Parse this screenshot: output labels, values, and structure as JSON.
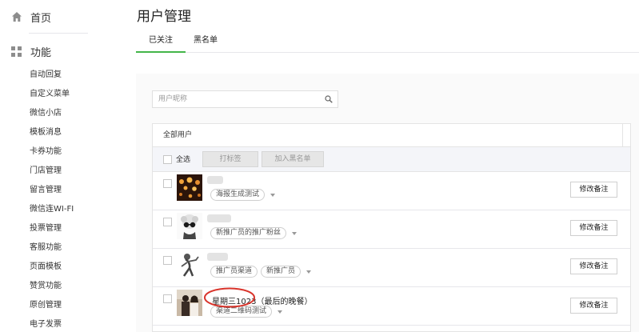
{
  "sidebar": {
    "home_label": "首页",
    "section_label": "功能",
    "items": [
      "自动回复",
      "自定义菜单",
      "微信小店",
      "模板消息",
      "卡券功能",
      "门店管理",
      "留言管理",
      "微信连WI-FI",
      "投票管理",
      "客服功能",
      "页面模板",
      "赞赏功能",
      "原创管理",
      "电子发票"
    ]
  },
  "page": {
    "title": "用户管理",
    "tabs": [
      {
        "label": "已关注",
        "active": true
      },
      {
        "label": "黑名单",
        "active": false
      }
    ]
  },
  "search": {
    "placeholder": "用户昵称"
  },
  "panel": {
    "header": "全部用户",
    "select_all": "全选",
    "tag_button": "打标签",
    "blacklist_button": "加入黑名单"
  },
  "users": [
    {
      "name": "",
      "tags": [
        "海报生成测试"
      ],
      "remark_button": "修改备注"
    },
    {
      "name": "",
      "tags": [
        "新推广员的推广粉丝"
      ],
      "remark_button": "修改备注"
    },
    {
      "name": "",
      "tags": [
        "推广员渠道",
        "新推广员"
      ],
      "remark_button": "修改备注"
    },
    {
      "name": "星期三1023（最后的晚餐）",
      "tags": [
        "渠道二维码测试"
      ],
      "remark_button": "修改备注"
    }
  ],
  "colors": {
    "accent": "#44b549",
    "highlight": "#d9342b"
  }
}
